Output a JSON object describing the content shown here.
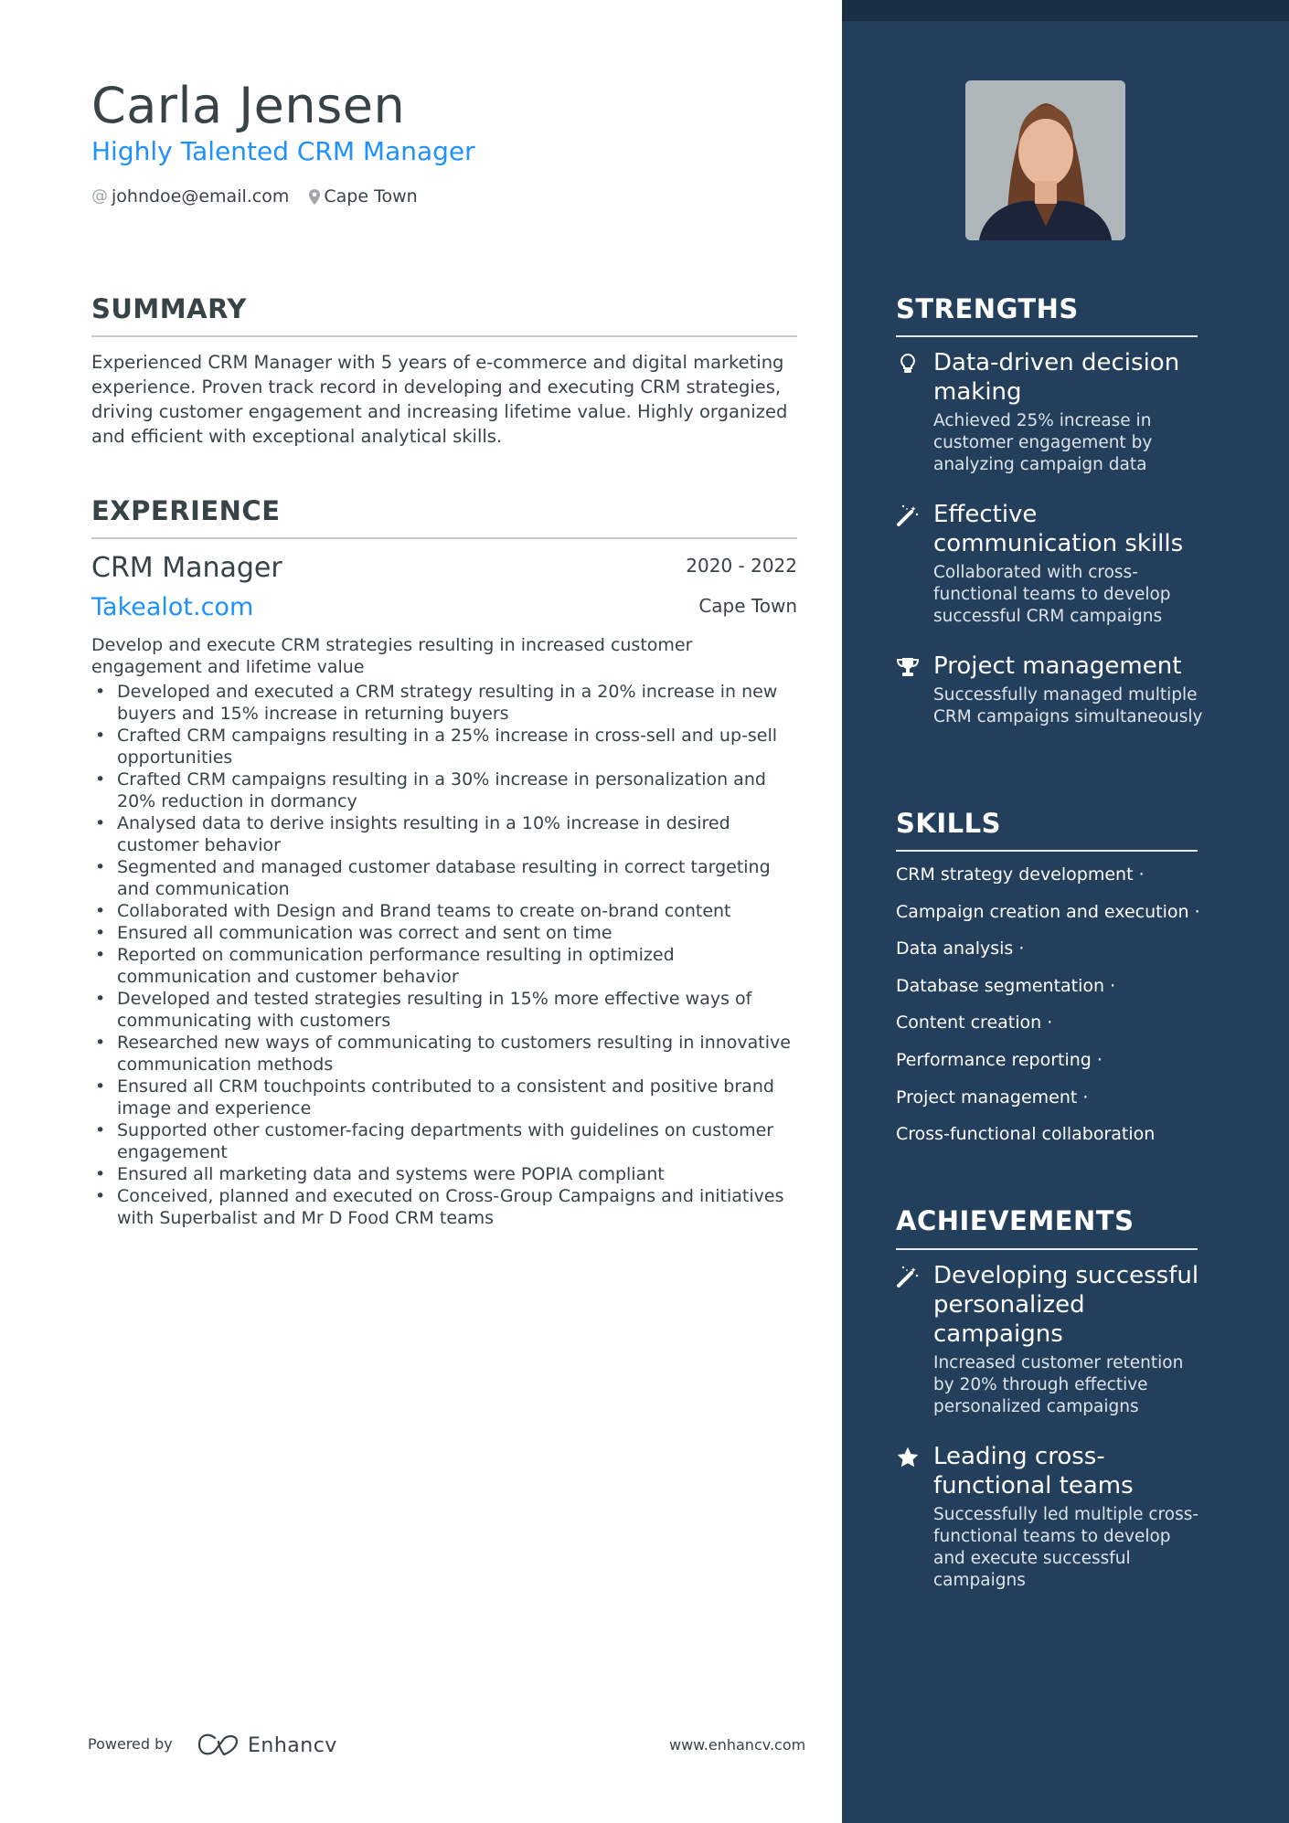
{
  "header": {
    "name": "Carla Jensen",
    "title": "Highly Talented CRM Manager",
    "contacts": [
      {
        "icon": "at-icon",
        "text": "johndoe@email.com"
      },
      {
        "icon": "location-pin-icon",
        "text": "Cape Town"
      }
    ]
  },
  "summary": {
    "heading": "SUMMARY",
    "text": "Experienced CRM Manager with 5 years of e-commerce and digital marketing experience. Proven track record in developing and executing CRM strategies, driving customer engagement and increasing lifetime value. Highly organized and efficient with exceptional analytical skills."
  },
  "experience": {
    "heading": "EXPERIENCE",
    "jobs": [
      {
        "title": "CRM Manager",
        "dates": "2020 - 2022",
        "company": "Takealot.com",
        "location": "Cape Town",
        "description": "Develop and execute CRM strategies resulting in increased customer engagement and lifetime value",
        "bullets": [
          "Developed and executed a CRM strategy resulting in a 20% increase in new buyers and 15% increase in returning buyers",
          "Crafted CRM campaigns resulting in a 25% increase in cross-sell and up-sell opportunities",
          "Crafted CRM campaigns resulting in a 30% increase in personalization and 20% reduction in dormancy",
          "Analysed data to derive insights resulting in a 10% increase in desired customer behavior",
          "Segmented and managed customer database resulting in correct targeting and communication",
          "Collaborated with Design and Brand teams to create on-brand content",
          "Ensured all communication was correct and sent on time",
          "Reported on communication performance resulting in optimized communication and customer behavior",
          "Developed and tested strategies resulting in 15% more effective ways of communicating with customers",
          "Researched new ways of communicating to customers resulting in innovative communication methods",
          "Ensured all CRM touchpoints contributed to a consistent and positive brand image and experience",
          "Supported other customer-facing departments with guidelines on customer engagement",
          "Ensured all marketing data and systems were POPIA compliant",
          "Conceived, planned and executed on Cross-Group Campaigns and initiatives with Superbalist and Mr D Food CRM teams"
        ]
      }
    ]
  },
  "strengths": {
    "heading": "STRENGTHS",
    "items": [
      {
        "icon": "lightbulb-icon",
        "title": "Data-driven decision making",
        "description": "Achieved 25% increase in customer engagement by analyzing campaign data"
      },
      {
        "icon": "magic-wand-icon",
        "title": "Effective communication skills",
        "description": "Collaborated with cross-functional teams to develop successful CRM campaigns"
      },
      {
        "icon": "trophy-icon",
        "title": "Project management",
        "description": "Successfully managed multiple CRM campaigns simultaneously"
      }
    ]
  },
  "skills": {
    "heading": "SKILLS",
    "items": [
      "CRM strategy development ·",
      "Campaign creation and execution ·",
      "Data analysis ·",
      "Database segmentation ·",
      "Content creation ·",
      "Performance reporting ·",
      "Project management ·",
      "Cross-functional collaboration"
    ]
  },
  "achievements": {
    "heading": "ACHIEVEMENTS",
    "items": [
      {
        "icon": "magic-wand-icon",
        "title": "Developing successful personalized campaigns",
        "description": "Increased customer retention by 20% through effective personalized campaigns"
      },
      {
        "icon": "star-icon",
        "title": "Leading cross-functional teams",
        "description": "Successfully led multiple cross-functional teams to develop and execute successful campaigns"
      }
    ]
  },
  "footer": {
    "powered_by": "Powered by",
    "brand": "Enhancv",
    "url": "www.enhancv.com"
  },
  "colors": {
    "accent": "#1e90ff",
    "sidebar": "#233f5c",
    "sidebar_topbar": "#1a2e45",
    "text": "#384347"
  }
}
